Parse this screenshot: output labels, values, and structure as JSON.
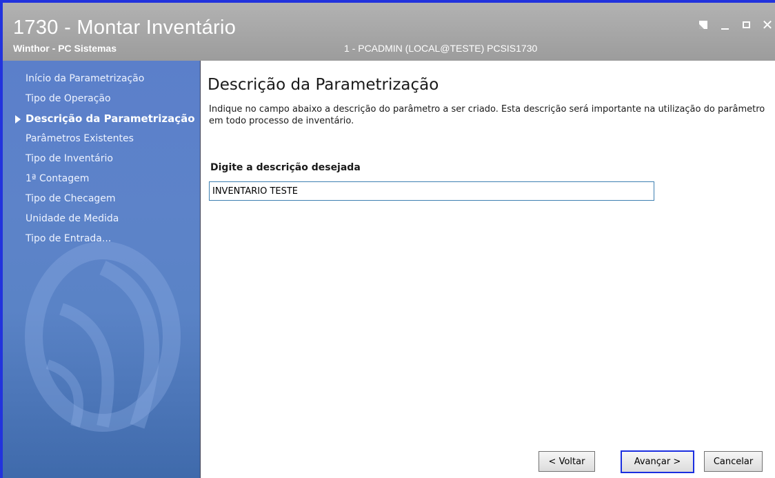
{
  "window": {
    "title": "1730 - Montar Inventário",
    "subtitle": "Winthor - PC Sistemas",
    "session": "1 - PCADMIN (LOCAL@TESTE)   PCSIS1730"
  },
  "sidebar": {
    "items": [
      {
        "label": "Início da Parametrização"
      },
      {
        "label": "Tipo de Operação"
      },
      {
        "label": "Descrição da Parametrização"
      },
      {
        "label": "Parâmetros Existentes"
      },
      {
        "label": "Tipo de Inventário"
      },
      {
        "label": "1ª Contagem"
      },
      {
        "label": "Tipo de Checagem"
      },
      {
        "label": "Unidade de Medida"
      },
      {
        "label": "Tipo de Entrada..."
      }
    ],
    "active_index": 2
  },
  "main": {
    "title": "Descrição da Parametrização",
    "description": "Indique no campo abaixo a descrição do parâmetro a ser criado. Esta descrição será importante na utilização do parâmetro em todo processo de inventário.",
    "field_label": "Digite a descrição desejada",
    "field_value": "INVENTÁRIO TESTE"
  },
  "buttons": {
    "back": "< Voltar",
    "next": "Avançar >",
    "cancel": "Cancelar"
  },
  "colors": {
    "window_border": "#2233dd",
    "titlebar": "#a8a8a8",
    "sidebar": "#5b7fca",
    "input_border": "#3c7fb1",
    "focused_button_border": "#1a2ee0"
  }
}
